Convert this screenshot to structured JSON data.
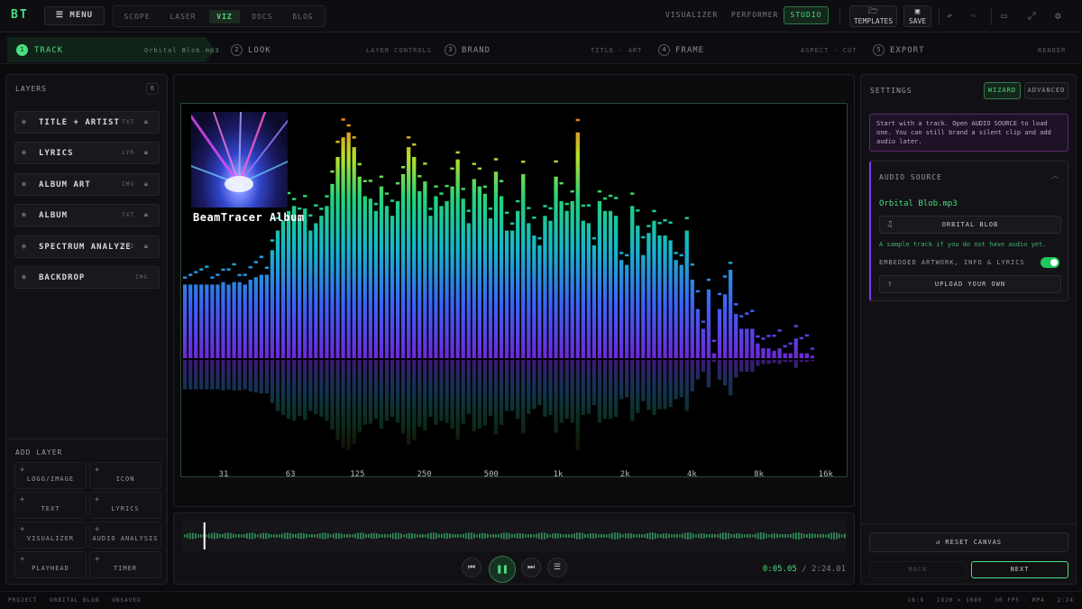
{
  "topbar": {
    "logo": "BT",
    "menu_label": "MENU",
    "modes": [
      "SCOPE",
      "LASER",
      "VIZ",
      "DOCS",
      "BLOG"
    ],
    "active_mode": "VIZ",
    "views": [
      "VISUALIZER",
      "PERFORMER",
      "STUDIO"
    ],
    "active_view": "STUDIO",
    "templates_label": "TEMPLATES",
    "save_label": "SAVE"
  },
  "steps": [
    {
      "num": "1",
      "label": "TRACK",
      "sub": "Orbital Blob.mp3"
    },
    {
      "num": "2",
      "label": "LOOK",
      "sub": "LAYER CONTROLS"
    },
    {
      "num": "3",
      "label": "BRAND",
      "sub": "TITLE · ART"
    },
    {
      "num": "4",
      "label": "FRAME",
      "sub": "ASPECT · CUT"
    },
    {
      "num": "5",
      "label": "EXPORT",
      "sub": "RENDER"
    }
  ],
  "layers": {
    "title": "LAYERS",
    "count": "6",
    "items": [
      {
        "name": "TITLE + ARTIST",
        "tag": "TXT",
        "locked": true
      },
      {
        "name": "LYRICS",
        "tag": "LYR",
        "locked": true
      },
      {
        "name": "ALBUM ART",
        "tag": "IMG",
        "locked": true
      },
      {
        "name": "ALBUM",
        "tag": "TXT",
        "locked": true
      },
      {
        "name": "SPECTRUM ANALYZE",
        "tag": "VIZ",
        "locked": true
      },
      {
        "name": "BACKDROP",
        "tag": "IMG",
        "locked": false
      }
    ],
    "add_title": "ADD LAYER",
    "add_items": [
      "LOGO/IMAGE",
      "ICON",
      "TEXT",
      "LYRICS",
      "VISUALIZER",
      "AUDIO ANALYSIS",
      "PLAYHEAD",
      "TIMER"
    ]
  },
  "canvas": {
    "album_title": "BeamTracer Album",
    "freq_labels": [
      "31",
      "63",
      "125",
      "250",
      "500",
      "1k",
      "2k",
      "4k",
      "8k",
      "16k"
    ],
    "spectrum_levels": [
      0.3,
      0.3,
      0.3,
      0.3,
      0.3,
      0.3,
      0.3,
      0.31,
      0.3,
      0.31,
      0.31,
      0.3,
      0.32,
      0.33,
      0.34,
      0.34,
      0.44,
      0.52,
      0.56,
      0.6,
      0.62,
      0.57,
      0.61,
      0.52,
      0.55,
      0.58,
      0.62,
      0.71,
      0.82,
      0.9,
      0.92,
      0.86,
      0.74,
      0.66,
      0.65,
      0.6,
      0.7,
      0.62,
      0.58,
      0.64,
      0.75,
      0.86,
      0.82,
      0.68,
      0.72,
      0.58,
      0.66,
      0.62,
      0.64,
      0.7,
      0.81,
      0.65,
      0.55,
      0.73,
      0.7,
      0.67,
      0.57,
      0.76,
      0.66,
      0.52,
      0.52,
      0.6,
      0.75,
      0.55,
      0.5,
      0.46,
      0.58,
      0.56,
      0.74,
      0.64,
      0.6,
      0.64,
      0.92,
      0.56,
      0.55,
      0.46,
      0.64,
      0.6,
      0.6,
      0.58,
      0.4,
      0.38,
      0.62,
      0.54,
      0.42,
      0.51,
      0.56,
      0.5,
      0.5,
      0.48,
      0.4,
      0.38,
      0.52,
      0.32,
      0.2,
      0.12,
      0.28,
      0.02,
      0.2,
      0.26,
      0.36,
      0.18,
      0.12,
      0.12,
      0.12,
      0.06,
      0.04,
      0.04,
      0.03,
      0.04,
      0.02,
      0.02,
      0.08,
      0.02,
      0.02,
      0.01
    ]
  },
  "timeline": {
    "current": "0:05.05",
    "total": "/ 2:24.01",
    "playhead": 0.02
  },
  "settings": {
    "title": "SETTINGS",
    "wizard_label": "WIZARD",
    "advanced_label": "ADVANCED",
    "hint": "Start with a track. Open AUDIO SOURCE to load one. You can still brand a silent clip and add audio later.",
    "source_title": "AUDIO SOURCE",
    "file": "Orbital Blob.mp3",
    "sample_button": "ORBITAL BLOB",
    "sample_hint": "A sample track if you do not have audio yet.",
    "embedded_label": "EMBEDDED ARTWORK, INFO & LYRICS",
    "embedded_on": true,
    "upload_label": "UPLOAD YOUR OWN",
    "reset_label": "RESET CANVAS",
    "back_label": "BACK",
    "next_label": "NEXT"
  },
  "status": {
    "left": "PROJECT · ORBITAL BLOB · UNSAVED",
    "right": "16:9 · 1920 × 1080 · 30 FPS · MP4 · 2:24"
  },
  "colors": {
    "accent": "#4ade80",
    "hint_border": "#5a2a6e",
    "source_accent": "#7c3aed"
  }
}
